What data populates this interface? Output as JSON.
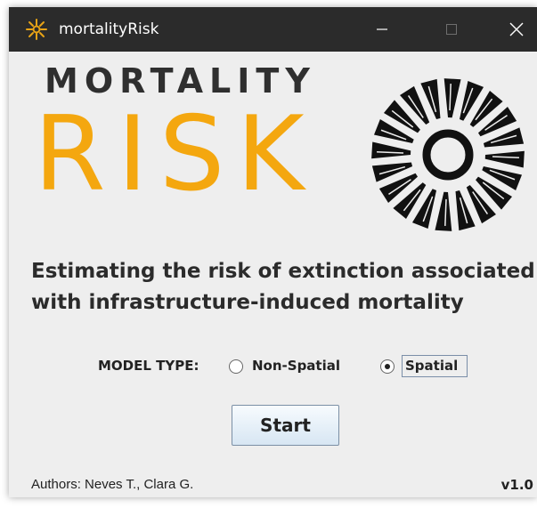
{
  "window": {
    "title": "mortalityRisk",
    "app_icon": "sunburst-icon",
    "controls": [
      "minimize-icon",
      "maximize-icon",
      "close-icon"
    ]
  },
  "logo": {
    "line1": "MORTALITY",
    "line2": "RISK",
    "emblem": "radial-burst-icon",
    "colors": {
      "dark": "#2f2f2f",
      "accent": "#f4a70f"
    }
  },
  "subtitle": {
    "line1": "Estimating the risk of extinction associated",
    "line2": "with infrastructure-induced mortality"
  },
  "model_type": {
    "label": "MODEL TYPE:",
    "options": [
      {
        "label": "Non-Spatial",
        "selected": false
      },
      {
        "label": "Spatial",
        "selected": true
      }
    ]
  },
  "start_button": {
    "label": "Start"
  },
  "footer": {
    "authors": "Authors: Neves T., Clara G.",
    "version": "v1.0"
  }
}
